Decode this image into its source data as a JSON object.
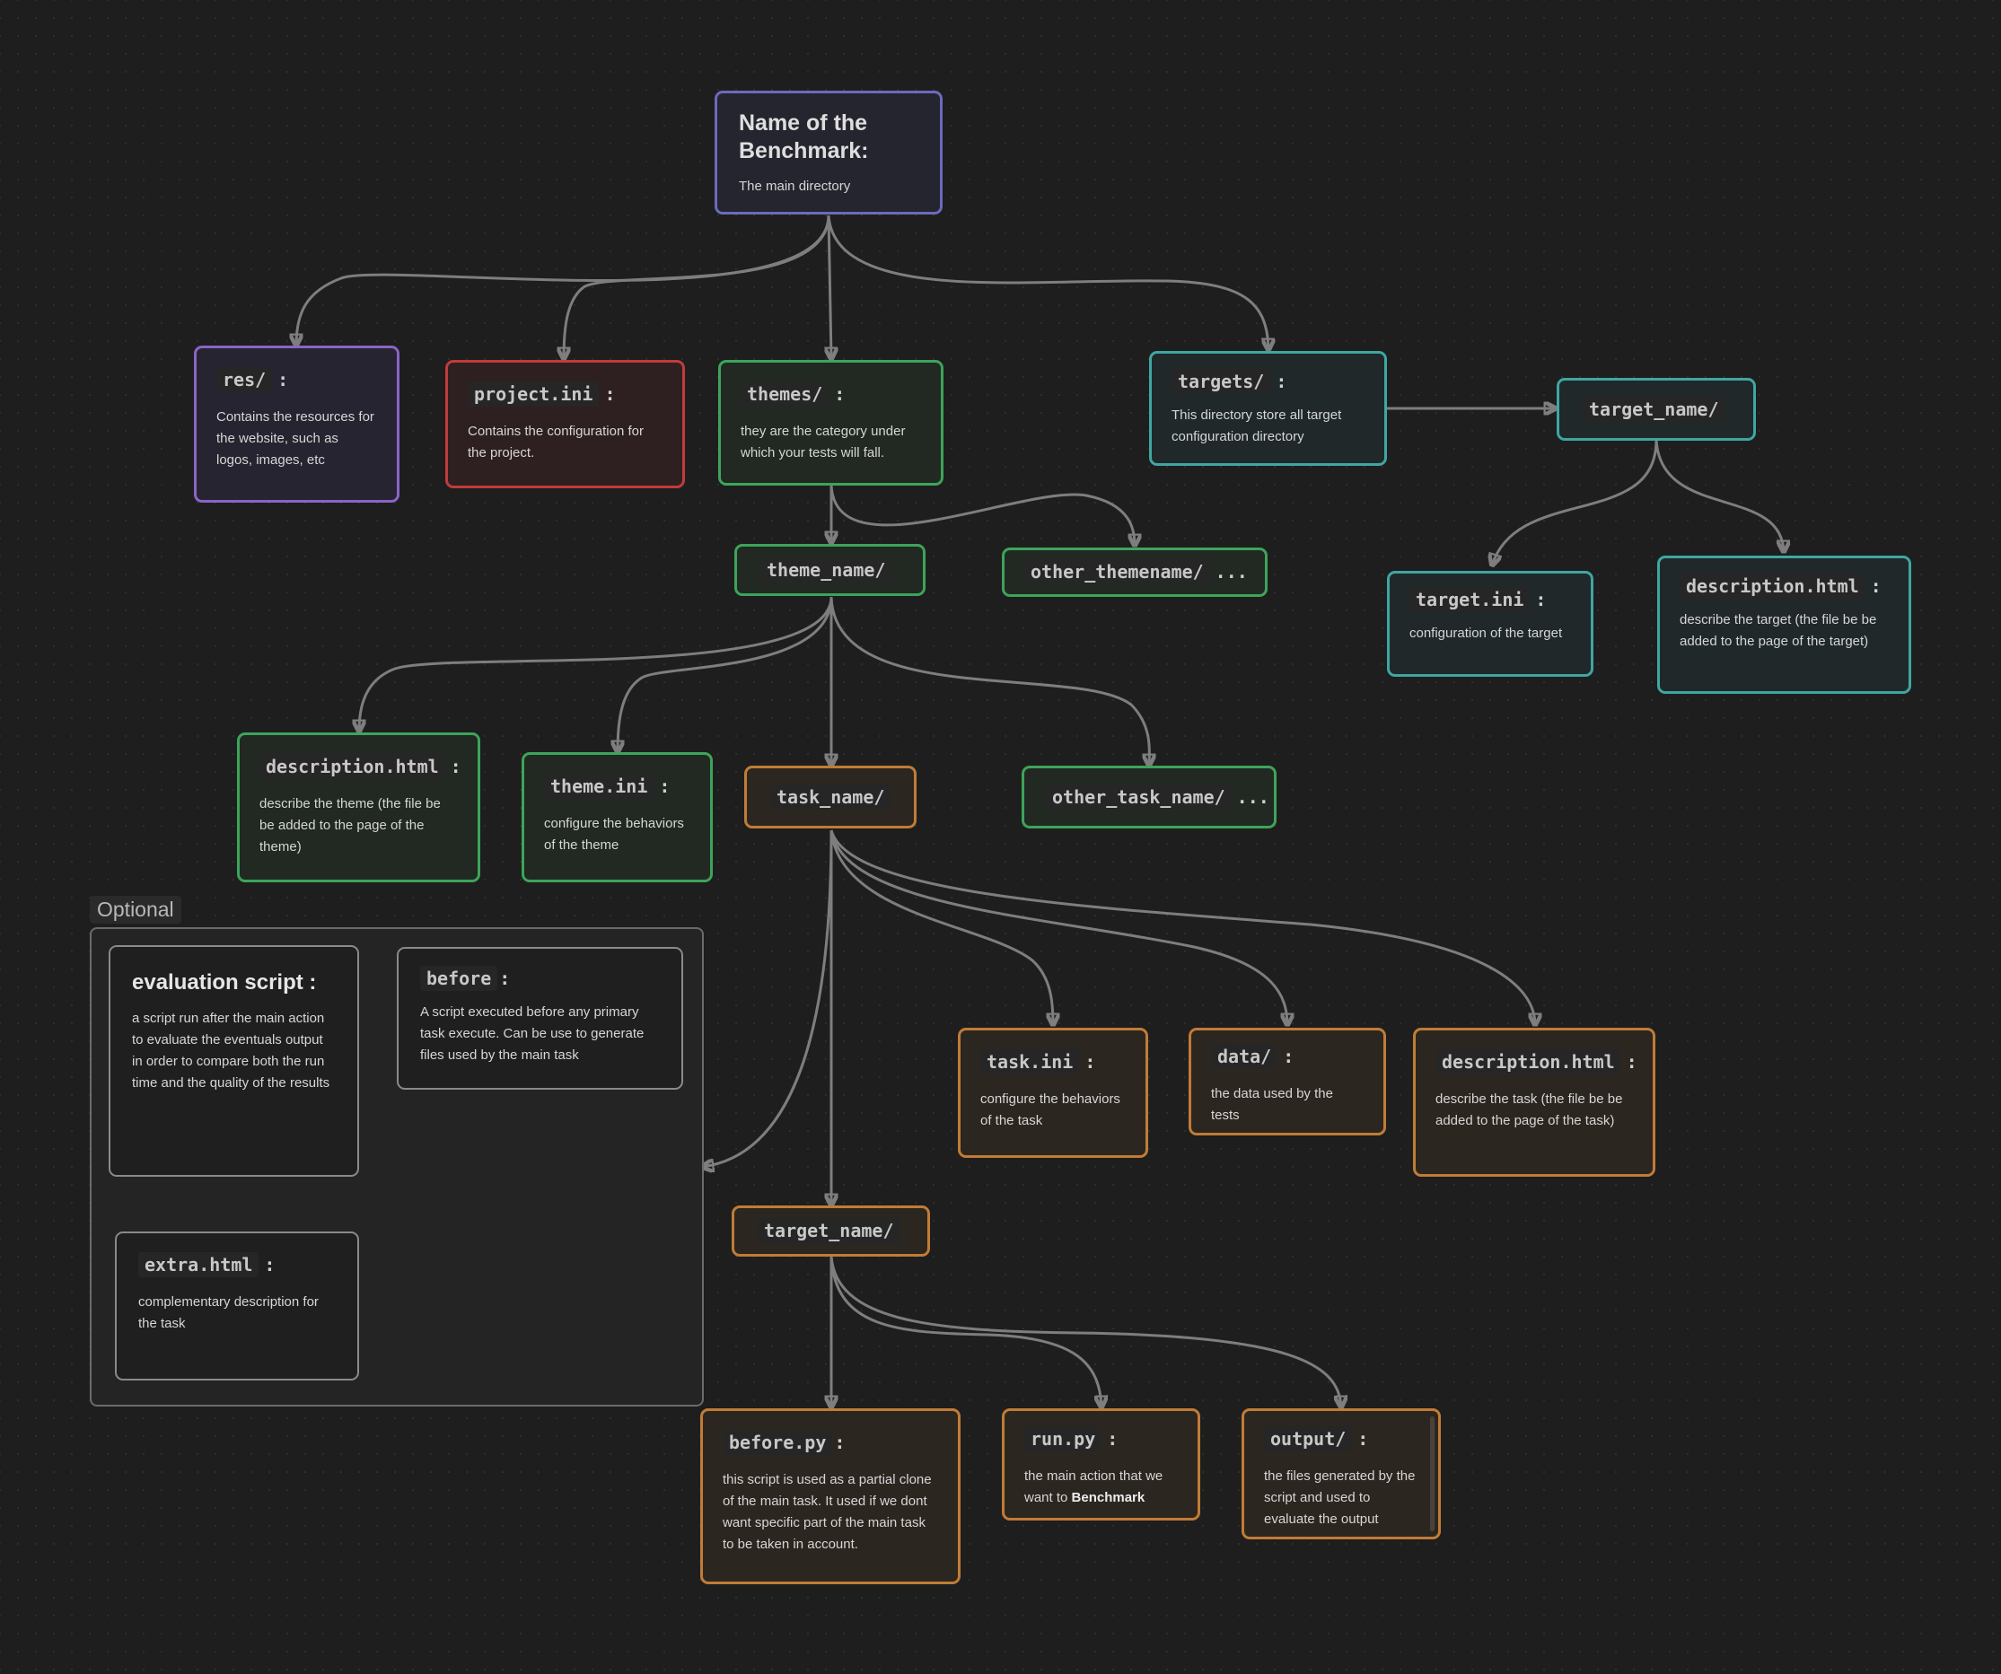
{
  "colors": {
    "root": "#6a6bbd",
    "res": "#8a64c8",
    "project": "#c23b3b",
    "themes": "#3da45a",
    "targets": "#3fa6a3",
    "task": "#c07c36",
    "optional": "#8a8a8a",
    "edge": "#7e7e7e",
    "background": "#1e1e1e"
  },
  "root": {
    "title": "Name of the Benchmark:",
    "desc": "The main directory"
  },
  "res": {
    "name": "res/",
    "desc": "Contains the resources for the website, such as logos, images, etc"
  },
  "project_ini": {
    "name": "project.ini",
    "desc": "Contains the configuration for the project."
  },
  "themes": {
    "name": "themes/",
    "desc": "they are the category under which your tests will fall."
  },
  "targets": {
    "name": "targets/",
    "desc": "This directory store all target configuration directory"
  },
  "targets_target_name": {
    "name": "target_name/"
  },
  "target_ini": {
    "name": "target.ini",
    "desc": "configuration of the target"
  },
  "target_description": {
    "name": "description.html",
    "desc": "describe the target (the file be be added to the page of the target)"
  },
  "theme_name": {
    "name": "theme_name/"
  },
  "other_themename": {
    "name": "other_themename/",
    "suffix": "..."
  },
  "theme_description": {
    "name": "description.html",
    "desc": "describe the theme (the file be be added to the page of the theme)"
  },
  "theme_ini": {
    "name": "theme.ini",
    "desc": "configure the behaviors of the theme"
  },
  "task_name": {
    "name": "task_name/"
  },
  "other_task_name": {
    "name": "other_task_name/",
    "suffix": "..."
  },
  "optional_group": {
    "label": "Optional",
    "evaluation_script": {
      "title": "evaluation script :",
      "desc": "a script run after the main action to evaluate the eventuals output in order to compare both the run time and the quality of the results"
    },
    "before": {
      "name": "before",
      "desc": "A script executed before any primary task execute. Can be use to generate files used by the main task"
    },
    "extra_html": {
      "name": "extra.html",
      "desc": "complementary description for the task"
    }
  },
  "task_ini": {
    "name": "task.ini",
    "desc": "configure the behaviors of the task"
  },
  "data_dir": {
    "name": "data/",
    "desc": "the data used by the tests"
  },
  "task_description": {
    "name": "description.html",
    "desc": "describe the task (the file be be added to the page of the task)"
  },
  "task_target_name": {
    "name": "target_name/"
  },
  "before_py": {
    "name": "before.py",
    "desc": "this script is used as a partial clone of the main task. It used if we dont want specific part of the main task to be taken in account."
  },
  "run_py": {
    "name": "run.py",
    "desc_prefix": "the main action that we want to ",
    "desc_bold": "Benchmark"
  },
  "output_dir": {
    "name": "output/",
    "desc": "the files generated by the script and used to evaluate the output"
  },
  "edges": [
    [
      "root",
      "res"
    ],
    [
      "root",
      "project_ini"
    ],
    [
      "root",
      "themes"
    ],
    [
      "root",
      "targets"
    ],
    [
      "targets",
      "targets_target_name"
    ],
    [
      "targets_target_name",
      "target_ini"
    ],
    [
      "targets_target_name",
      "target_description"
    ],
    [
      "themes",
      "theme_name"
    ],
    [
      "themes",
      "other_themename"
    ],
    [
      "theme_name",
      "theme_description"
    ],
    [
      "theme_name",
      "theme_ini"
    ],
    [
      "theme_name",
      "task_name"
    ],
    [
      "theme_name",
      "other_task_name"
    ],
    [
      "task_name",
      "optional_group"
    ],
    [
      "task_name",
      "task_ini"
    ],
    [
      "task_name",
      "data_dir"
    ],
    [
      "task_name",
      "task_description"
    ],
    [
      "task_name",
      "task_target_name"
    ],
    [
      "task_target_name",
      "before_py"
    ],
    [
      "task_target_name",
      "run_py"
    ],
    [
      "task_target_name",
      "output_dir"
    ]
  ]
}
